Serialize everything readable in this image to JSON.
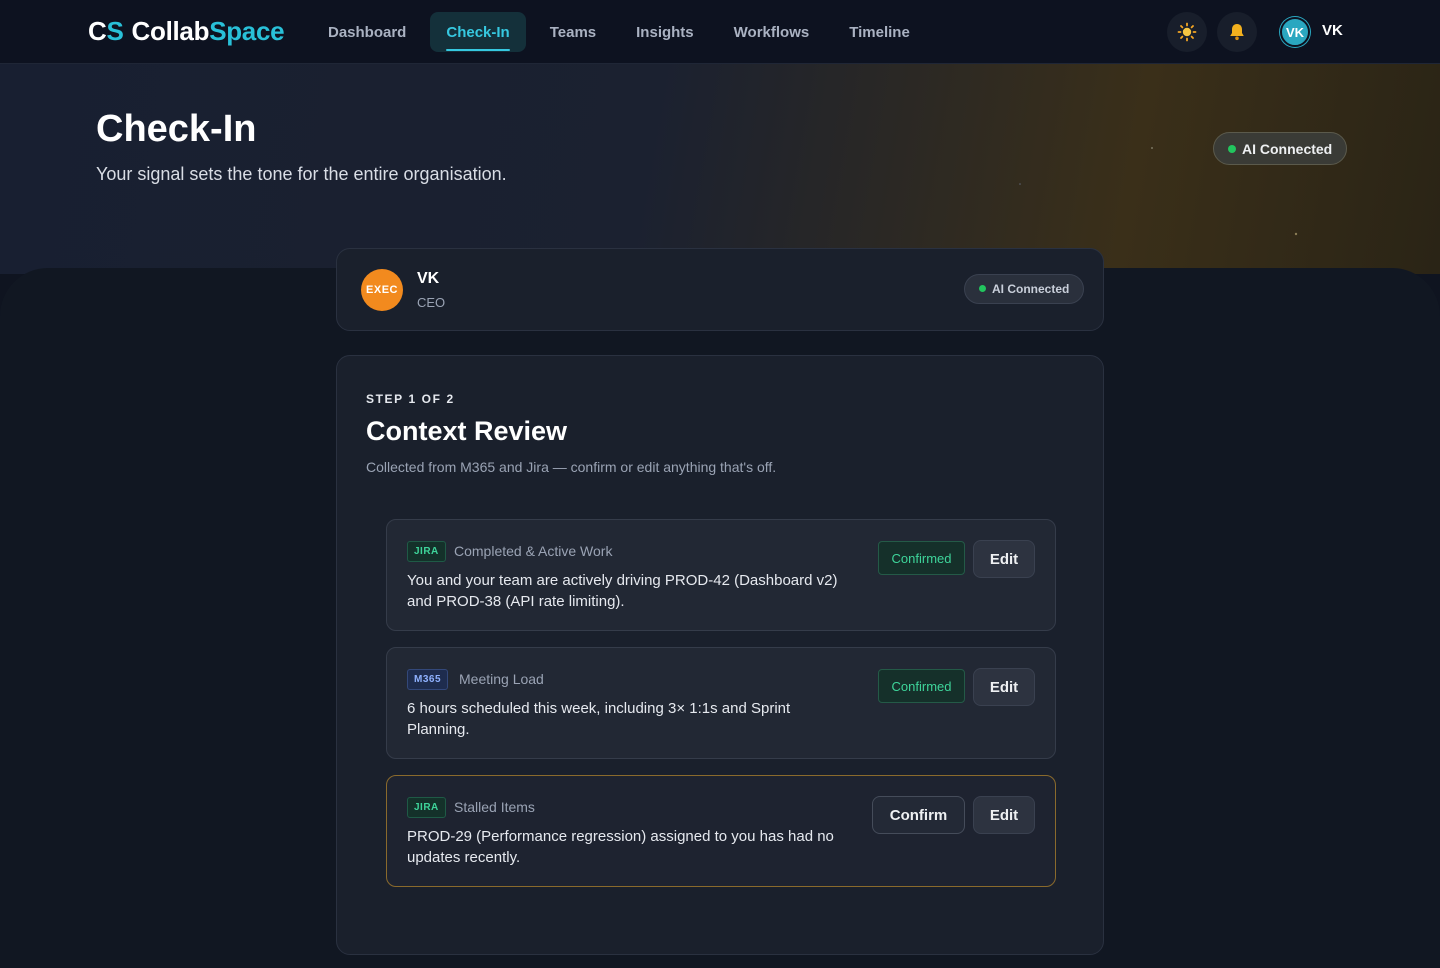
{
  "brand": {
    "mono_a": "C",
    "mono_b": "S",
    "name_a": "Collab",
    "name_b": "Space"
  },
  "nav": {
    "items": [
      {
        "label": "Dashboard",
        "active": false
      },
      {
        "label": "Check-In",
        "active": true
      },
      {
        "label": "Teams",
        "active": false
      },
      {
        "label": "Insights",
        "active": false
      },
      {
        "label": "Workflows",
        "active": false
      },
      {
        "label": "Timeline",
        "active": false
      }
    ]
  },
  "header": {
    "theme_icon": "sun-icon",
    "notification_icon": "bell-icon",
    "user_initials": "VK",
    "user_name": "VK"
  },
  "hero": {
    "title": "Check-In",
    "subtitle": "Your signal sets the tone for the entire organisation.",
    "status": "AI Connected"
  },
  "user_card": {
    "badge": "EXEC",
    "name": "VK",
    "role": "CEO",
    "status": "AI Connected"
  },
  "review": {
    "step": "STEP 1 OF 2",
    "title": "Context Review",
    "subtitle": "Collected from M365 and Jira — confirm or edit anything that's off.",
    "items": [
      {
        "source": "JIRA",
        "category": "Completed & Active Work",
        "text": "You and your team are actively driving PROD-42 (Dashboard v2) and PROD-38 (API rate limiting).",
        "state": "Confirmed",
        "edit": "Edit"
      },
      {
        "source": "M365",
        "category": "Meeting Load",
        "text": "6 hours scheduled this week, including 3× 1:1s and Sprint Planning.",
        "state": "Confirmed",
        "edit": "Edit"
      },
      {
        "source": "JIRA",
        "category": "Stalled Items",
        "text": "PROD-29 (Performance regression) assigned to you has had no updates recently.",
        "action": "Confirm",
        "edit": "Edit"
      }
    ]
  },
  "colors": {
    "accent": "#36c8e0",
    "status_green": "#22c55e",
    "jira_tag": "#3ed49a",
    "m365_tag": "#8fb1ff",
    "exec_badge": "#f28a1e",
    "warning_border": "#8a6a2c"
  }
}
